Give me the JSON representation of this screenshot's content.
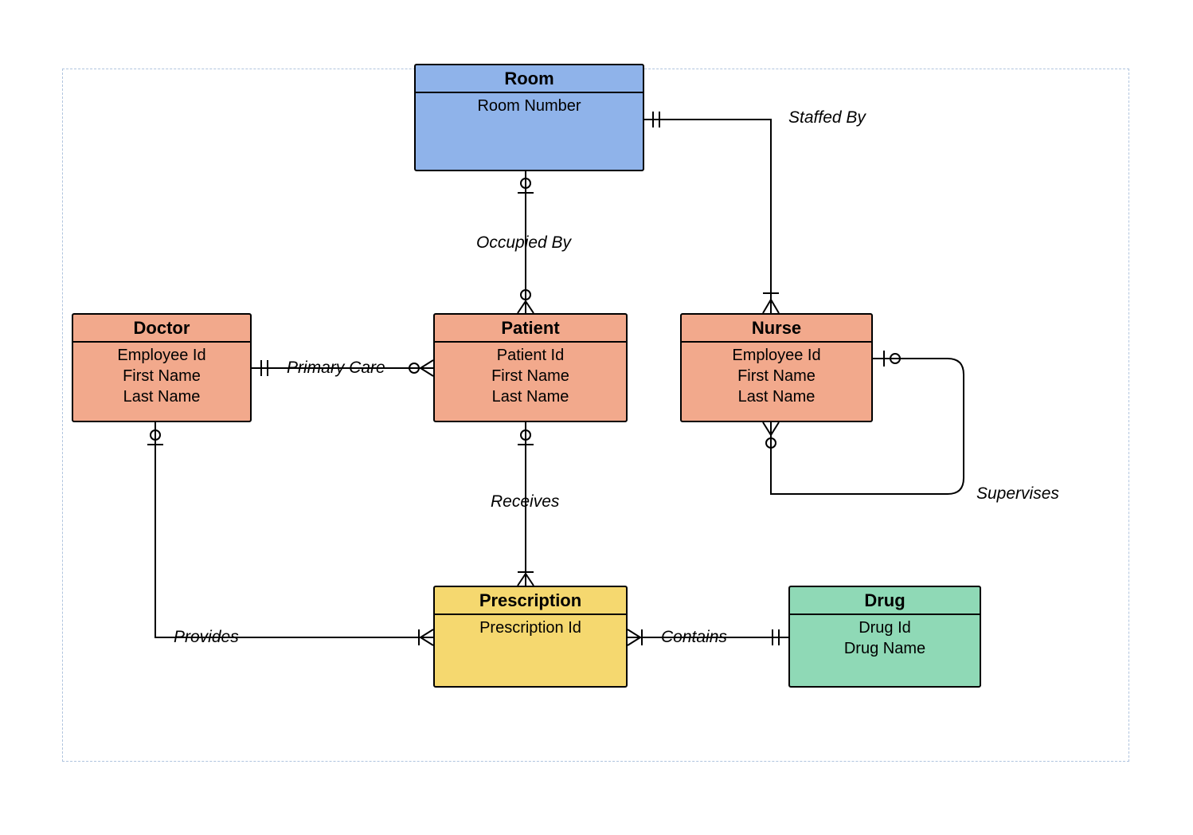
{
  "entities": {
    "room": {
      "title": "Room",
      "attrs": [
        "Room Number"
      ]
    },
    "doctor": {
      "title": "Doctor",
      "attrs": [
        "Employee Id",
        "First Name",
        "Last Name"
      ]
    },
    "patient": {
      "title": "Patient",
      "attrs": [
        "Patient Id",
        "First Name",
        "Last Name"
      ]
    },
    "nurse": {
      "title": "Nurse",
      "attrs": [
        "Employee Id",
        "First Name",
        "Last Name"
      ]
    },
    "prescription": {
      "title": "Prescription",
      "attrs": [
        "Prescription Id"
      ]
    },
    "drug": {
      "title": "Drug",
      "attrs": [
        "Drug Id",
        "Drug Name"
      ]
    }
  },
  "relationships": {
    "staffed_by": "Staffed By",
    "occupied_by": "Occupied By",
    "primary_care": "Primary Care",
    "receives": "Receives",
    "provides": "Provides",
    "contains": "Contains",
    "supervises": "Supervises"
  },
  "colors": {
    "blue": "#8fb3ea",
    "coral": "#f2a98c",
    "yellow": "#f5d86f",
    "green": "#8fd9b6"
  }
}
